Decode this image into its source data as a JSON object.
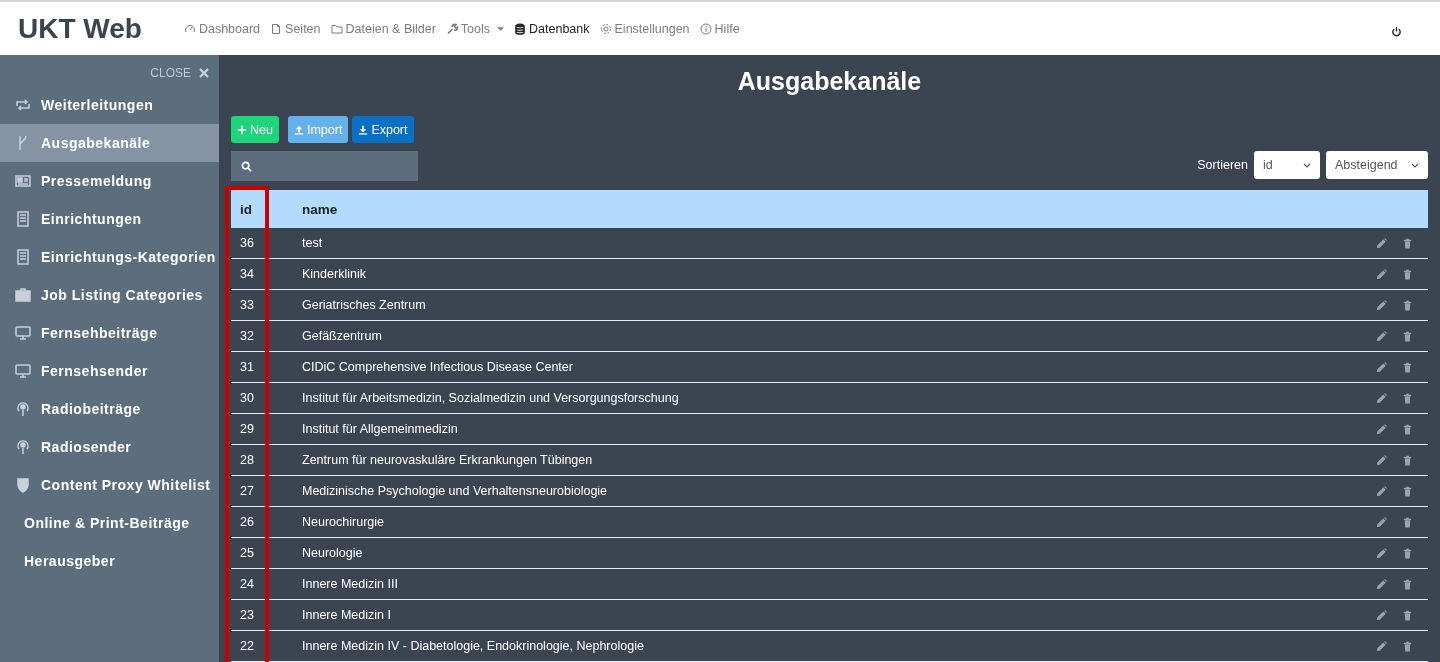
{
  "brand": "UKT Web",
  "nav": [
    {
      "label": "Dashboard",
      "selected": false
    },
    {
      "label": "Seiten",
      "selected": false
    },
    {
      "label": "Dateien & Bilder",
      "selected": false
    },
    {
      "label": "Tools",
      "selected": false,
      "dropdown": true
    },
    {
      "label": "Datenbank",
      "selected": true
    },
    {
      "label": "Einstellungen",
      "selected": false
    },
    {
      "label": "Hilfe",
      "selected": false
    }
  ],
  "sidebar": {
    "close": "CLOSE",
    "items": [
      {
        "label": "Weiterleitungen",
        "selected": false
      },
      {
        "label": "Ausgabekanäle",
        "selected": true
      },
      {
        "label": "Pressemeldung",
        "selected": false
      },
      {
        "label": "Einrichtungen",
        "selected": false
      },
      {
        "label": "Einrichtungs-Kategorien",
        "selected": false
      },
      {
        "label": "Job Listing Categories",
        "selected": false
      },
      {
        "label": "Fernsehbeiträge",
        "selected": false
      },
      {
        "label": "Fernsehsender",
        "selected": false
      },
      {
        "label": "Radiobeiträge",
        "selected": false
      },
      {
        "label": "Radiosender",
        "selected": false
      },
      {
        "label": "Content Proxy Whitelist",
        "selected": false
      },
      {
        "label": "Online & Print-Beiträge",
        "selected": false
      },
      {
        "label": "Herausgeber",
        "selected": false
      }
    ]
  },
  "page_title": "Ausgabekanäle",
  "buttons": [
    {
      "label": "Neu",
      "kind": "new"
    },
    {
      "label": "Import",
      "kind": "import"
    },
    {
      "label": "Export",
      "kind": "export"
    }
  ],
  "sort": {
    "label": "Sortieren",
    "field": "id",
    "order": "Absteigend"
  },
  "table": {
    "columns": [
      "id",
      "name"
    ],
    "rows": [
      [
        "36",
        "test"
      ],
      [
        "34",
        "Kinderklinik"
      ],
      [
        "33",
        "Geriatrisches Zentrum"
      ],
      [
        "32",
        "Gefäßzentrum"
      ],
      [
        "31",
        "CIDiC Comprehensive Infectious Disease Center"
      ],
      [
        "30",
        "Institut für Arbeitsmedizin, Sozialmedizin und Versorgungsforschung"
      ],
      [
        "29",
        "Institut für Allgemeinmedizin"
      ],
      [
        "28",
        "Zentrum für neurovaskuläre Erkrankungen Tübingen"
      ],
      [
        "27",
        "Medizinische Psychologie und Verhaltensneurobiologie"
      ],
      [
        "26",
        "Neurochirurgie"
      ],
      [
        "25",
        "Neurologie"
      ],
      [
        "24",
        "Innere Medizin III"
      ],
      [
        "23",
        "Innere Medizin I"
      ],
      [
        "22",
        "Innere Medizin IV - Diabetologie, Endokrinologie, Nephrologie"
      ]
    ]
  }
}
